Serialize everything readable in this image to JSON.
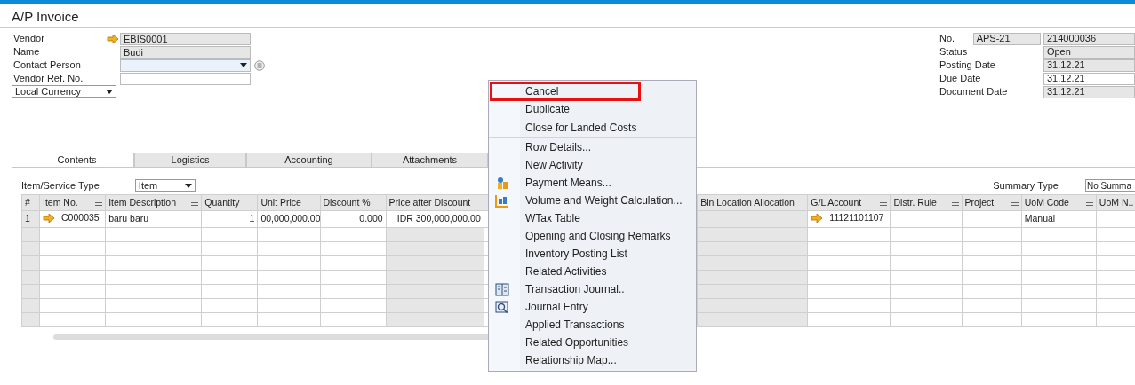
{
  "window": {
    "title": "A/P Invoice"
  },
  "header_left": [
    {
      "label": "Vendor",
      "value": "EBIS0001",
      "kind": "linked"
    },
    {
      "label": "Name",
      "value": "Budi",
      "kind": "readonly"
    },
    {
      "label": "Contact Person",
      "kind": "dropdown"
    },
    {
      "label": "Vendor Ref. No.",
      "kind": "text"
    }
  ],
  "currency_select": {
    "value": "Local Currency"
  },
  "header_right": [
    {
      "label": "No.",
      "series": "APS-21",
      "value": "214000036",
      "kind": "readonly"
    },
    {
      "label": "Status",
      "value": "Open",
      "kind": "readonly"
    },
    {
      "label": "Posting Date",
      "value": "31.12.21",
      "kind": "readonly"
    },
    {
      "label": "Due Date",
      "value": "31.12.21",
      "kind": "text"
    },
    {
      "label": "Document Date",
      "value": "31.12.21",
      "kind": "readonly"
    }
  ],
  "tabs": [
    {
      "label": "Contents",
      "selected": true
    },
    {
      "label": "Logistics",
      "selected": false
    },
    {
      "label": "Accounting",
      "selected": false
    },
    {
      "label": "Attachments",
      "selected": false
    }
  ],
  "item_service_type": {
    "label": "Item/Service Type",
    "value": "Item"
  },
  "summary_type": {
    "label": "Summary Type",
    "value": "No Summa"
  },
  "table": {
    "columns": [
      {
        "label": "#",
        "kind": "shaded"
      },
      {
        "label": "Item No.",
        "kind": "menu"
      },
      {
        "label": "Item Description",
        "kind": "menu"
      },
      {
        "label": "Quantity",
        "kind": "plain"
      },
      {
        "label": "Unit Price",
        "kind": "plain"
      },
      {
        "label": "Discount %",
        "kind": "plain"
      },
      {
        "label": "Price after Discount",
        "kind": "shaded"
      },
      {
        "label": "Bin Location Allocation",
        "kind": "shaded"
      },
      {
        "label": "G/L Account",
        "kind": "menu"
      },
      {
        "label": "Distr. Rule",
        "kind": "menu"
      },
      {
        "label": "Project",
        "kind": "menu"
      },
      {
        "label": "UoM Code",
        "kind": "menu"
      },
      {
        "label": "UoM N..",
        "kind": "plain"
      }
    ],
    "rows": [
      {
        "cells": [
          {
            "text": "1",
            "kind": "text"
          },
          {
            "text": "C000035",
            "kind": "link"
          },
          {
            "text": "baru baru",
            "kind": "text"
          },
          {
            "text": "1",
            "kind": "number"
          },
          {
            "text": "00,000,000.00",
            "kind": "number"
          },
          {
            "text": "0.000",
            "kind": "number"
          },
          {
            "text": "IDR 300,000,000.00",
            "kind": "number"
          },
          null,
          {
            "text": "11121101107",
            "kind": "link"
          },
          null,
          null,
          {
            "text": "Manual",
            "kind": "text"
          },
          null
        ]
      }
    ]
  },
  "context_menu": {
    "items": [
      {
        "label": "Cancel",
        "highlighted": true,
        "separator_after": false,
        "kind": "plain"
      },
      {
        "label": "Duplicate",
        "highlighted": false,
        "separator_after": false,
        "kind": "plain"
      },
      {
        "label": "Close for Landed Costs",
        "highlighted": false,
        "separator_after": true,
        "kind": "plain"
      },
      {
        "label": "Row Details...",
        "highlighted": false,
        "separator_after": false,
        "kind": "plain"
      },
      {
        "label": "New Activity",
        "highlighted": false,
        "separator_after": false,
        "kind": "plain"
      },
      {
        "label": "Payment Means...",
        "highlighted": false,
        "separator_after": false,
        "kind": "coins"
      },
      {
        "label": "Volume and Weight Calculation...",
        "highlighted": false,
        "separator_after": false,
        "kind": "chart"
      },
      {
        "label": "WTax Table",
        "highlighted": false,
        "separator_after": false,
        "kind": "plain"
      },
      {
        "label": "Opening and Closing Remarks",
        "highlighted": false,
        "separator_after": false,
        "kind": "plain"
      },
      {
        "label": "Inventory Posting List",
        "highlighted": false,
        "separator_after": false,
        "kind": "plain"
      },
      {
        "label": "Related Activities",
        "highlighted": false,
        "separator_after": false,
        "kind": "plain"
      },
      {
        "label": "Transaction Journal..",
        "highlighted": false,
        "separator_after": false,
        "kind": "ledger"
      },
      {
        "label": "Journal Entry",
        "highlighted": false,
        "separator_after": false,
        "kind": "search"
      },
      {
        "label": "Applied Transactions",
        "highlighted": false,
        "separator_after": false,
        "kind": "plain"
      },
      {
        "label": "Related Opportunities",
        "highlighted": false,
        "separator_after": false,
        "kind": "plain"
      },
      {
        "label": "Relationship Map...",
        "highlighted": false,
        "separator_after": false,
        "kind": "plain"
      }
    ]
  }
}
